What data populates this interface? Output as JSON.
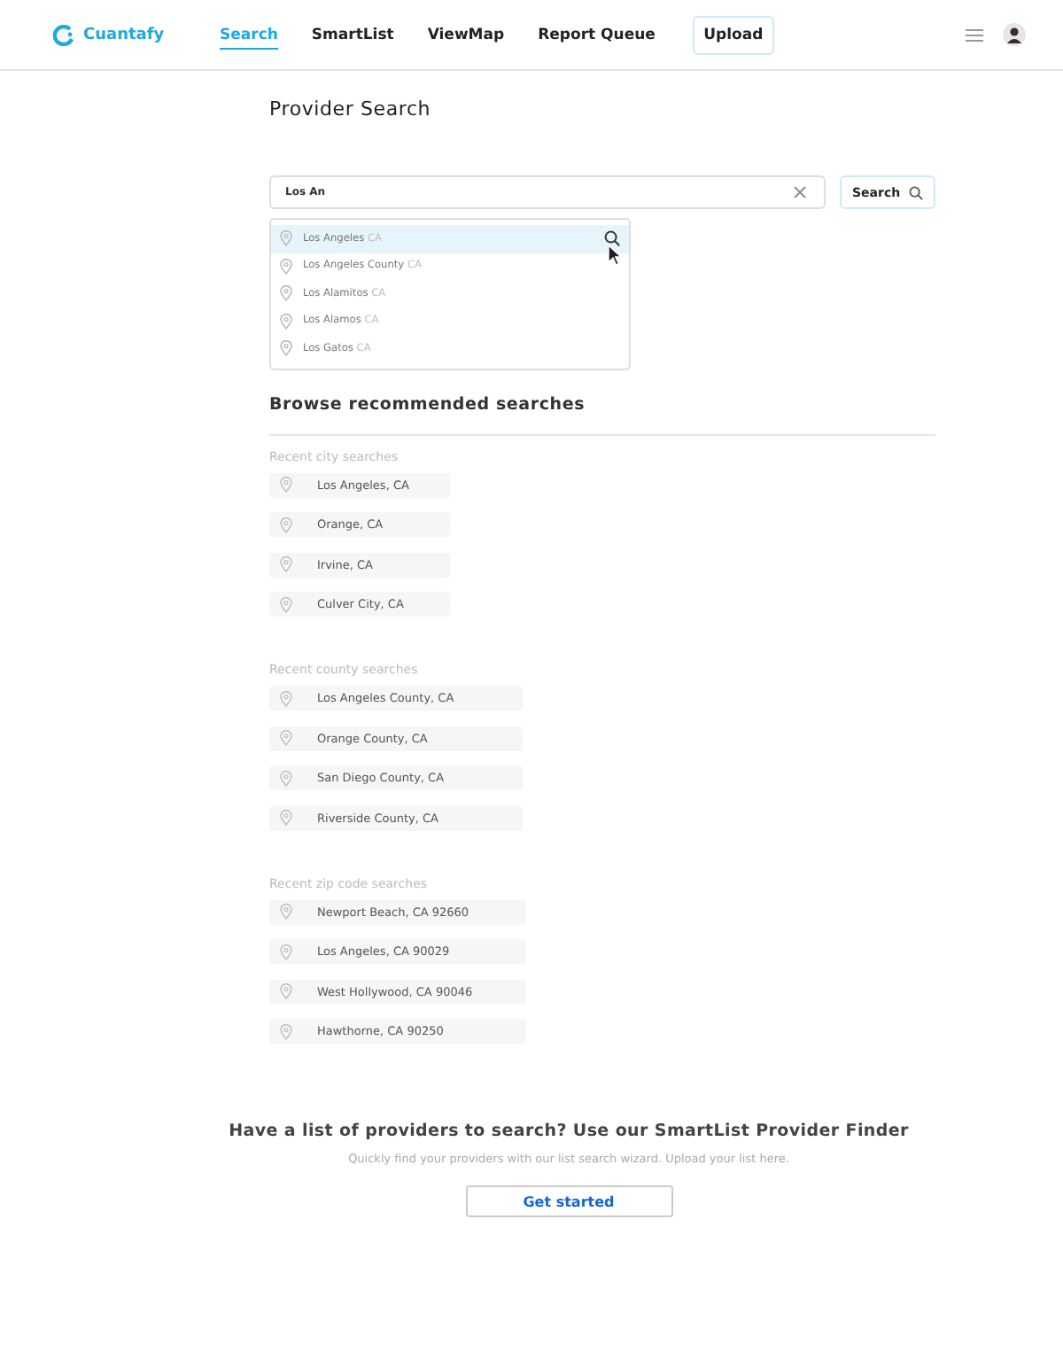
{
  "brand": {
    "name": "Cuantafy"
  },
  "nav": [
    {
      "label": "Search",
      "selected": true
    },
    {
      "label": "SmartList",
      "selected": false
    },
    {
      "label": "ViewMap",
      "selected": false
    },
    {
      "label": "Report Queue",
      "selected": false
    }
  ],
  "upload_button": "Upload",
  "page_title": "Provider Search",
  "search": {
    "value": "Los An",
    "button": "Search"
  },
  "suggestions": [
    {
      "name": "Los Angeles",
      "state": "CA",
      "selected": true
    },
    {
      "name": "Los Angeles County",
      "state": "CA",
      "selected": false
    },
    {
      "name": "Los Alamitos",
      "state": "CA",
      "selected": false
    },
    {
      "name": "Los Alamos",
      "state": "CA",
      "selected": false
    },
    {
      "name": "Los Gatos",
      "state": "CA",
      "selected": false
    }
  ],
  "browse_heading": "Browse recommended searches",
  "groups": [
    {
      "label": "Recent city searches",
      "items": [
        "Los Angeles, CA",
        "Orange, CA",
        "Irvine, CA",
        "Culver City, CA"
      ]
    },
    {
      "label": "Recent county searches",
      "items": [
        "Los Angeles County, CA",
        "Orange County, CA",
        "San Diego County, CA",
        "Riverside County, CA"
      ]
    },
    {
      "label": "Recent zip code searches",
      "items": [
        "Newport Beach, CA 92660",
        "Los Angeles, CA 90029",
        "West Hollywood, CA 90046",
        "Hawthorne, CA 90250"
      ]
    }
  ],
  "promo": {
    "title": "Have a list of providers to search? Use our SmartList Provider Finder",
    "subtitle": "Quickly find your providers with our list search wizard. Upload your list here.",
    "button": "Get started"
  }
}
